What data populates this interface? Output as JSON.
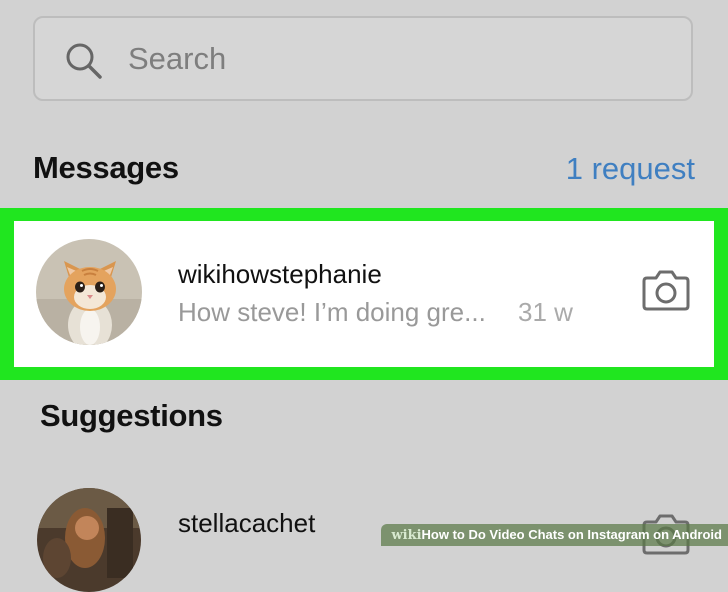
{
  "search": {
    "placeholder": "Search",
    "icon": "search-icon"
  },
  "messages": {
    "title": "Messages",
    "request_link": "1 request",
    "accent_color": "#3f7fc1",
    "threads": [
      {
        "username": "wikihowstephanie",
        "preview": "How steve! I’m doing gre...",
        "time": "31 w",
        "avatar": "kitten-avatar",
        "action_icon": "camera-icon",
        "highlighted": true
      }
    ]
  },
  "highlight_color": "#20e61f",
  "suggestions": {
    "title": "Suggestions",
    "items": [
      {
        "username": "stellacachet",
        "avatar": "photo-avatar",
        "action_icon": "camera-icon"
      }
    ]
  },
  "watermark": {
    "brand_wiki": "wiki",
    "brand_how": "How",
    "text": "to Do Video Chats on Instagram on Android"
  }
}
